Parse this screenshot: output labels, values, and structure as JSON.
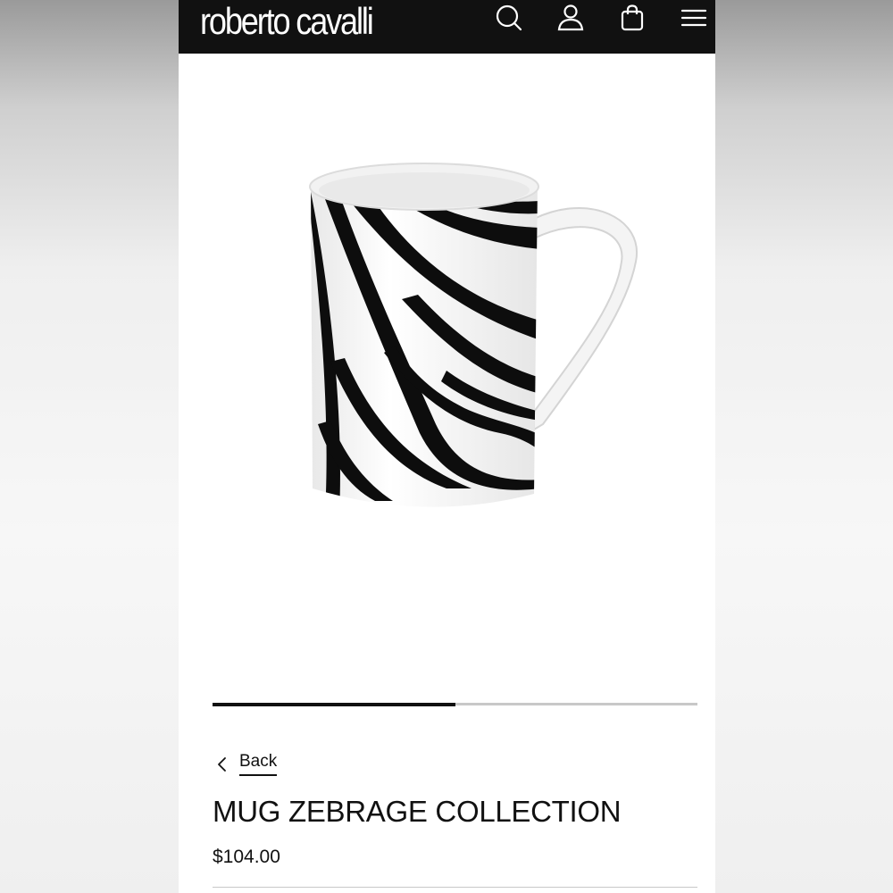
{
  "header": {
    "brand": "roberto cavalli",
    "icons": [
      "search-icon",
      "account-icon",
      "shopping-bag-icon",
      "menu-icon"
    ],
    "background_color": "#111111",
    "icon_color": "#ffffff"
  },
  "product": {
    "image_alt": "zebra pattern mug",
    "gallery_progress": 0.5,
    "back_label": "Back",
    "title": "MUG ZEBRAGE COLLECTION",
    "price": "$104.00"
  }
}
